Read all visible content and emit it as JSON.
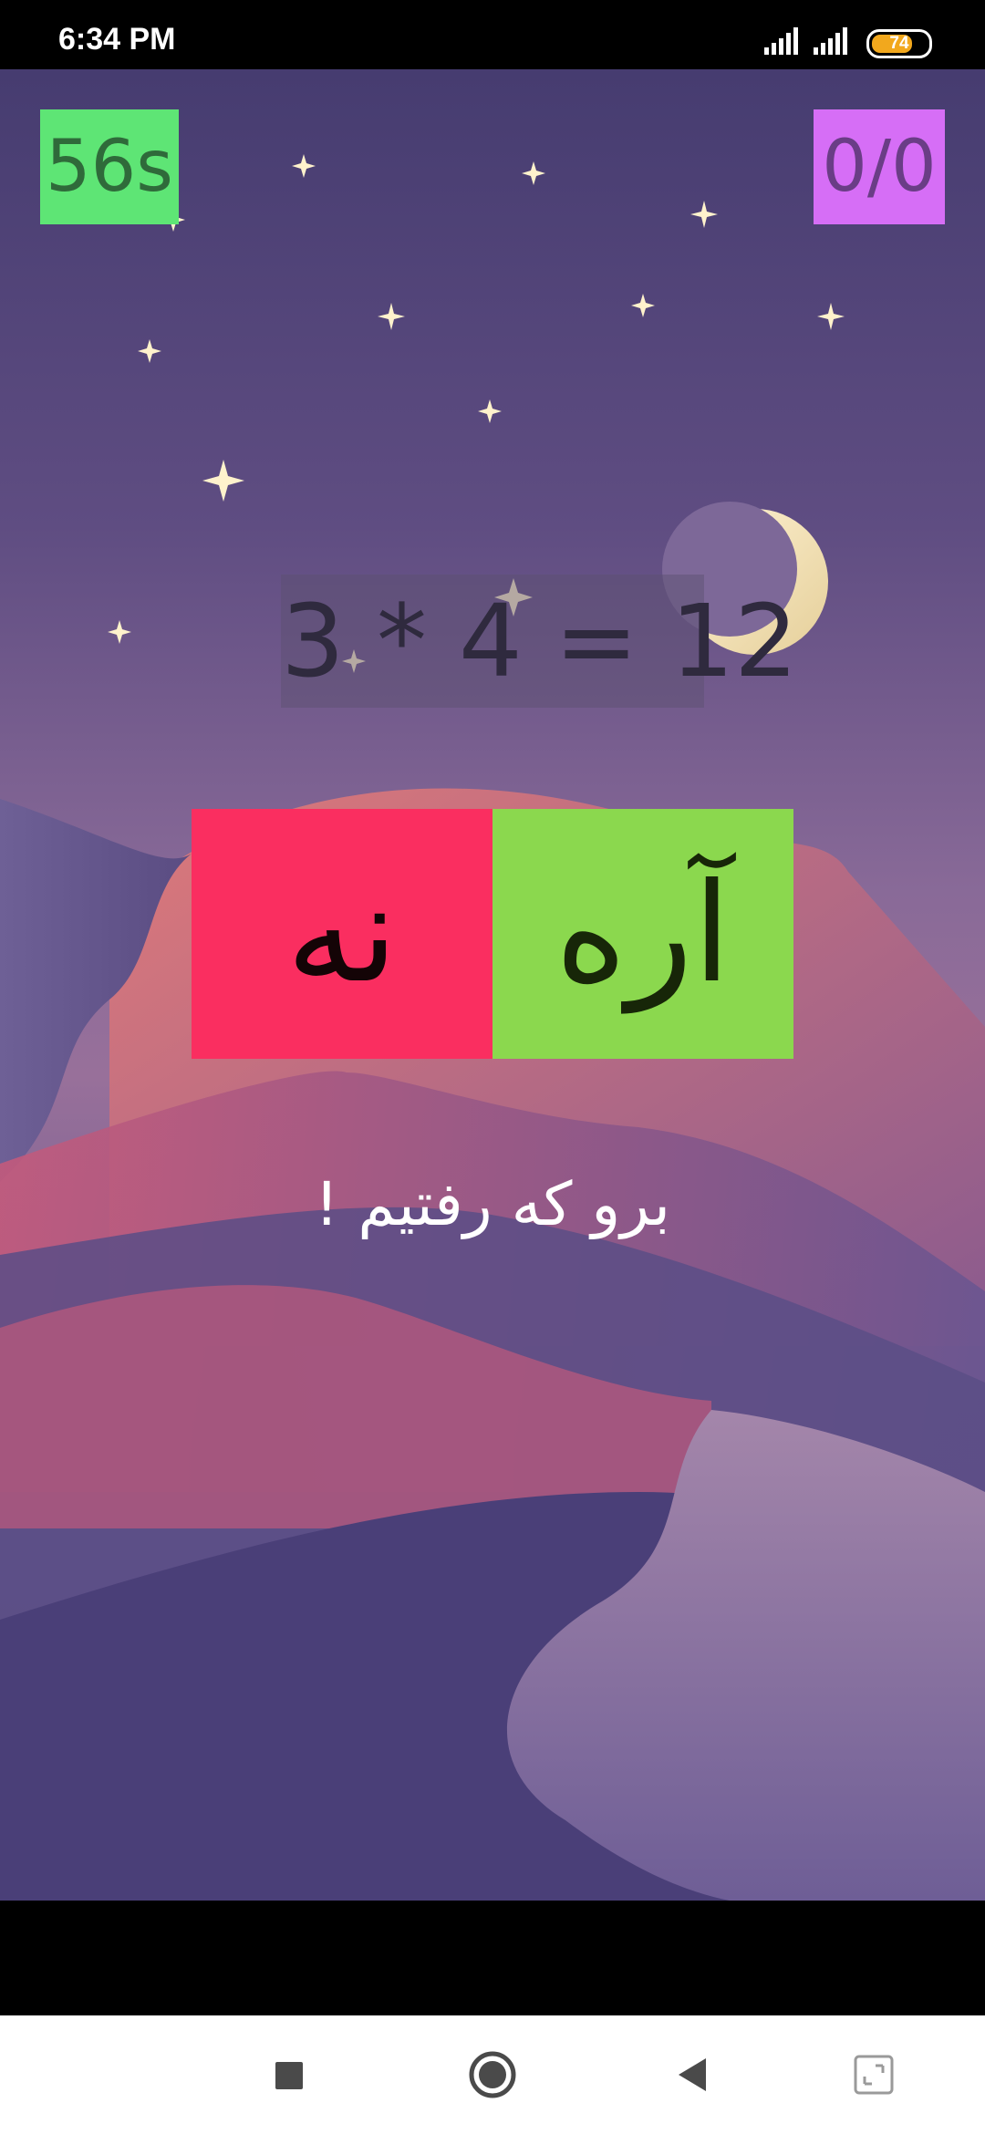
{
  "status_bar": {
    "time": "6:34 PM",
    "battery_level": "74",
    "icons": [
      "signal-icon",
      "signal-icon",
      "battery-icon"
    ]
  },
  "game": {
    "timer": "56s",
    "score": "0/0",
    "equation": "3 * 4 = 12",
    "no_label": "نه",
    "yes_label": "آره",
    "message": "برو که رفتیم !",
    "colors": {
      "timer_bg": "#5ee575",
      "score_bg": "#d66ef6",
      "no_bg": "#fa2e60",
      "yes_bg": "#8bd84e"
    }
  },
  "nav_bar": {
    "icons": [
      "recent-apps-icon",
      "home-icon",
      "back-icon",
      "screen-rotate-icon"
    ]
  }
}
